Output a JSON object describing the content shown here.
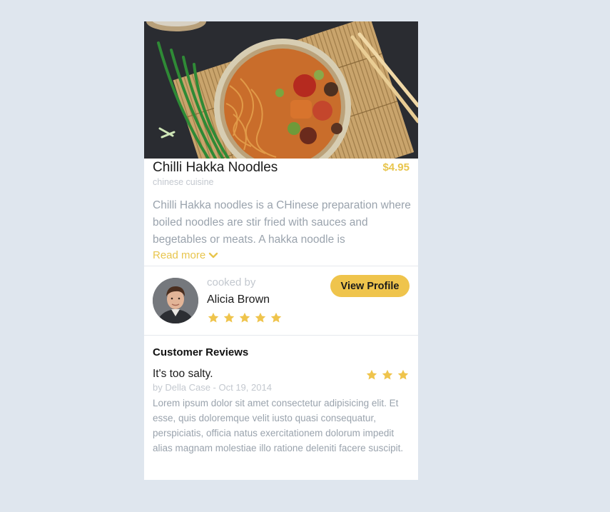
{
  "dish": {
    "title": "Chilli Hakka Noodles",
    "price": "$4.95",
    "cuisine": "chinese cuisine",
    "description": "Chilli Hakka noodles is a CHinese preparation where boiled noodles are stir fried with sauces and begetables or meats. A hakka noodle is",
    "read_more_label": "Read more",
    "image_icon": "noodle-bowl-photo"
  },
  "cook": {
    "label": "cooked by",
    "name": "Alicia Brown",
    "rating": 5,
    "rating_max": 5,
    "profile_button_label": "View Profile"
  },
  "reviews": {
    "section_title": "Customer Reviews",
    "items": [
      {
        "heading": "It's too salty.",
        "meta": "by Della Case - Oct 19, 2014",
        "rating": 3,
        "body": "Lorem ipsum dolor sit amet consectetur adipisicing elit. Et esse, quis doloremque velit iusto quasi consequatur, perspiciatis, officia natus exercitationem dolorum impedit alias magnam molestiae illo ratione deleniti facere suscipit."
      }
    ]
  },
  "colors": {
    "accent": "#efc44c",
    "star": "#efc44c",
    "price": "#e8c54d",
    "muted_text": "#9aa3ad",
    "light_text": "#c3c8cf",
    "page_background": "#dfe6ee"
  }
}
